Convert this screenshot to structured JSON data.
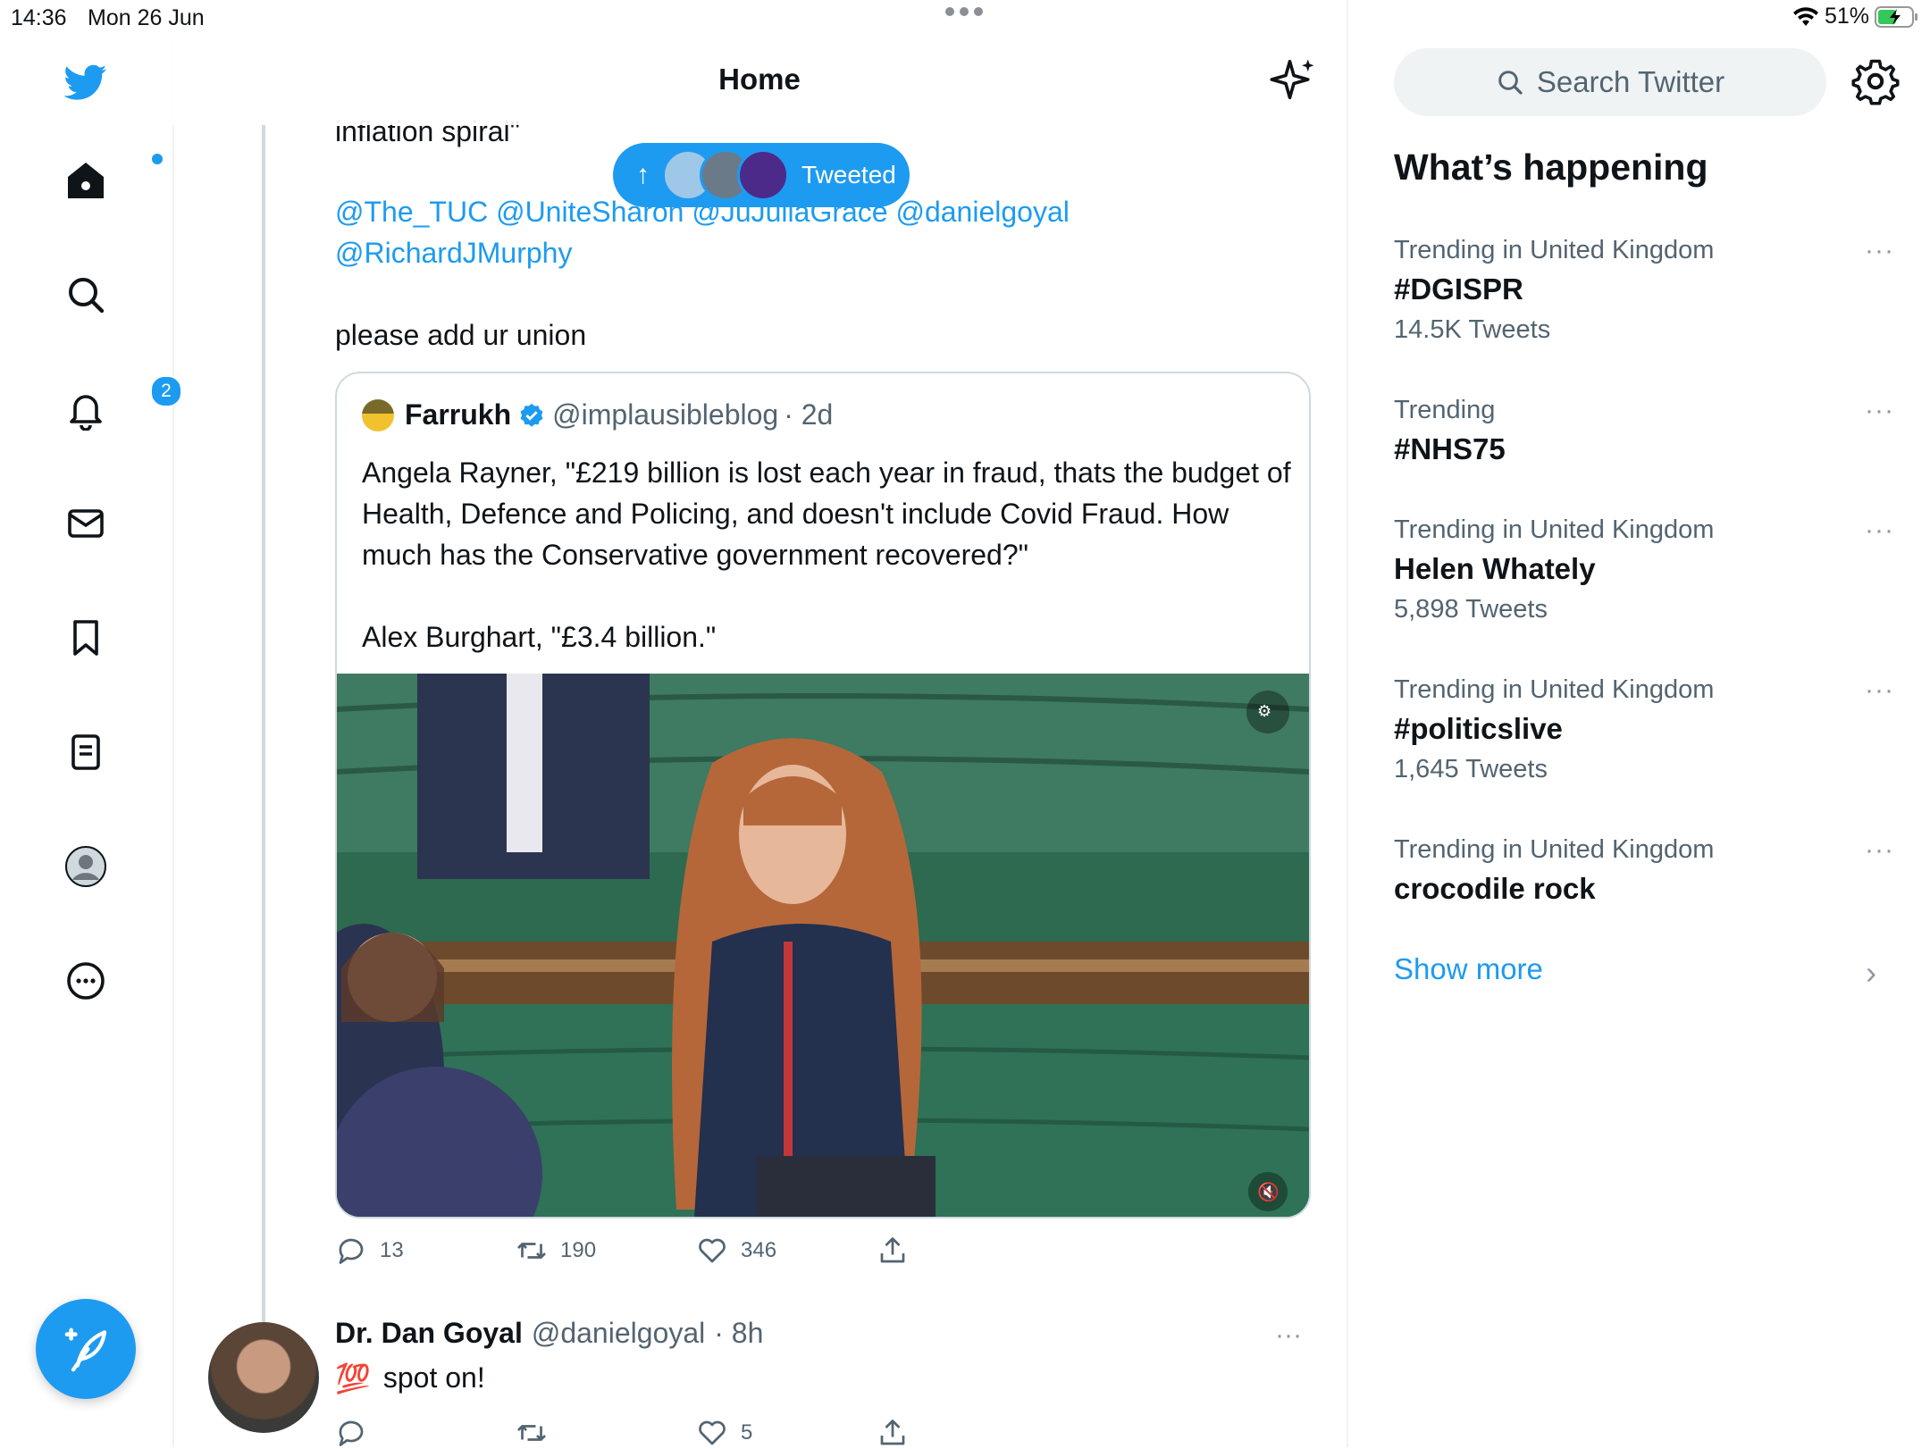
{
  "status": {
    "time": "14:36",
    "date": "Mon 26 Jun",
    "battery": "51%"
  },
  "nav": {
    "notifications_badge": "2"
  },
  "header": {
    "title": "Home"
  },
  "pill": {
    "label": "Tweeted"
  },
  "tweet": {
    "text_top": "inflation spiral\"",
    "mentions_line1": "@The_TUC @UniteSharon @JuJuliaGrace @danielgoyal",
    "mentions_line2": "@RichardJMurphy",
    "text_bottom": "please add ur union",
    "quote": {
      "name": "Farrukh",
      "handle": "@implausibleblog",
      "time": "· 2d",
      "text1": "Angela Rayner, \"£219 billion is lost each year in fraud, thats the budget of Health, Defence and Policing, and doesn't include Covid Fraud. How much has the Conservative government recovered?\"",
      "text2": "Alex Burghart, \"£3.4 billion.\""
    },
    "actions": {
      "replies": "13",
      "retweets": "190",
      "likes": "346"
    }
  },
  "reply": {
    "name": "Dr. Dan Goyal",
    "handle": "@danielgoyal",
    "time": "· 8h",
    "emoji": "💯",
    "text": "spot on!",
    "likes": "5"
  },
  "sidebar": {
    "search_placeholder": "Search Twitter",
    "heading": "What’s happening",
    "trends": [
      {
        "category": "Trending in United Kingdom",
        "name": "#DGISPR",
        "count": "14.5K Tweets"
      },
      {
        "category": "Trending",
        "name": "#NHS75",
        "count": ""
      },
      {
        "category": "Trending in United Kingdom",
        "name": "Helen Whately",
        "count": "5,898 Tweets"
      },
      {
        "category": "Trending in United Kingdom",
        "name": "#politicslive",
        "count": "1,645 Tweets"
      },
      {
        "category": "Trending in United Kingdom",
        "name": "crocodile rock",
        "count": ""
      }
    ],
    "show_more": "Show more"
  },
  "colors": {
    "accent": "#1d9bf0",
    "text": "#0f1419",
    "muted": "#536471",
    "border": "#cfd9de"
  }
}
